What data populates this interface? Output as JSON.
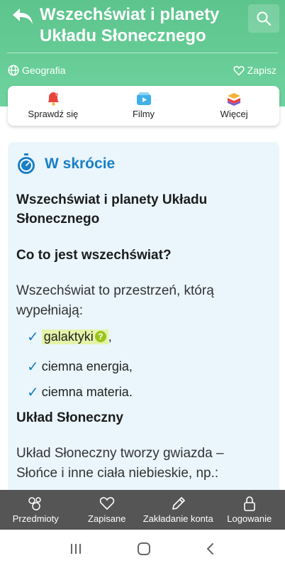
{
  "header": {
    "title": "Wszechświat i planety Układu Słonecznego",
    "subject": "Geografia",
    "save_label": "Zapisz"
  },
  "tabs": [
    {
      "label": "Sprawdź się",
      "icon": "bell-icon"
    },
    {
      "label": "Filmy",
      "icon": "play-icon"
    },
    {
      "label": "Więcej",
      "icon": "layers-icon"
    }
  ],
  "summary": {
    "section_title": "W skrócie",
    "heading": "Wszechświat i planety Układu Słonecznego",
    "subheading": "Co to jest wszechświat?",
    "intro": "Wszechświat to przestrzeń, którą wypełniają:",
    "list": [
      {
        "text": "galaktyki",
        "suffix": ",",
        "glossary": true
      },
      {
        "text": "ciemna energia,",
        "suffix": "",
        "glossary": false
      },
      {
        "text": "ciemna materia.",
        "suffix": "",
        "glossary": false
      }
    ],
    "glossary_mark": "?",
    "check_mark": "✓",
    "subheading2": "Układ Słoneczny",
    "paragraph2": "Układ Słoneczny tworzy gwiazda – Słońce i inne ciała niebieskie, np.:"
  },
  "bottom_nav": [
    {
      "label": "Przedmioty",
      "icon": "subjects-icon"
    },
    {
      "label": "Zapisane",
      "icon": "heart-icon"
    },
    {
      "label": "Zakładanie konta",
      "icon": "pencil-icon"
    },
    {
      "label": "Logowanie",
      "icon": "lock-icon"
    }
  ],
  "colors": {
    "header": "#5cc48c",
    "accent_blue": "#1a7fc4",
    "summary_bg": "#eaf6fc",
    "nav_bg": "#555555",
    "glossary_bg": "#e5f3a8"
  }
}
